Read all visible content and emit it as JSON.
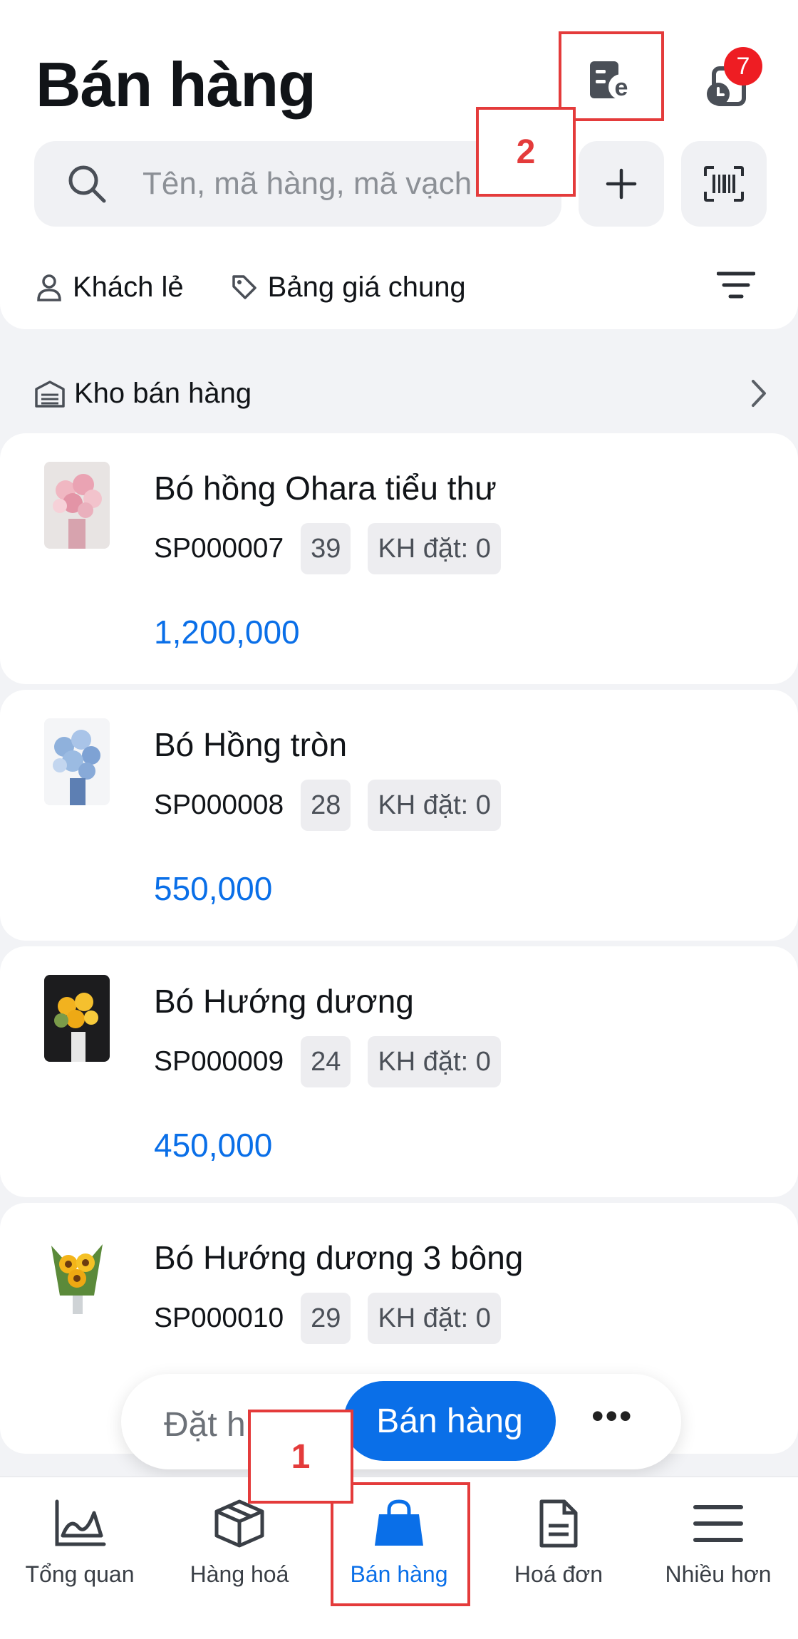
{
  "header": {
    "title": "Bán hàng",
    "invoice_icon": "e-invoice-icon",
    "history_icon": "history-clock-icon",
    "history_badge": "7"
  },
  "search": {
    "placeholder": "Tên, mã hàng, mã vạch",
    "add_icon": "plus-icon",
    "barcode_icon": "barcode-scan-icon"
  },
  "filters": {
    "customer": "Khách lẻ",
    "price_list": "Bảng giá chung",
    "filter_icon": "filter-icon"
  },
  "warehouse": {
    "label": "Kho bán hàng"
  },
  "products": [
    {
      "name": "Bó hồng Ohara tiểu thư",
      "code": "SP000007",
      "stock": "39",
      "ordered": "KH đặt: 0",
      "price": "1,200,000"
    },
    {
      "name": "Bó Hồng tròn",
      "code": "SP000008",
      "stock": "28",
      "ordered": "KH đặt: 0",
      "price": "550,000"
    },
    {
      "name": "Bó Hướng dương",
      "code": "SP000009",
      "stock": "24",
      "ordered": "KH đặt: 0",
      "price": "450,000"
    },
    {
      "name": "Bó Hướng dương 3 bông",
      "code": "SP000010",
      "stock": "29",
      "ordered": "KH đặt: 0",
      "price": ""
    }
  ],
  "action_bar": {
    "order": "Đặt h",
    "sell": "Bán hàng",
    "more": "•••"
  },
  "nav": [
    {
      "label": "Tổng quan",
      "icon": "chart-icon"
    },
    {
      "label": "Hàng hoá",
      "icon": "box-icon"
    },
    {
      "label": "Bán hàng",
      "icon": "shopping-bag-icon"
    },
    {
      "label": "Hoá đơn",
      "icon": "document-icon"
    },
    {
      "label": "Nhiều hơn",
      "icon": "menu-icon"
    }
  ],
  "annotations": {
    "label_1": "1",
    "label_2": "2"
  },
  "colors": {
    "accent": "#0a6fe8",
    "badge": "#ee1d23",
    "highlight": "#e43b3b"
  }
}
